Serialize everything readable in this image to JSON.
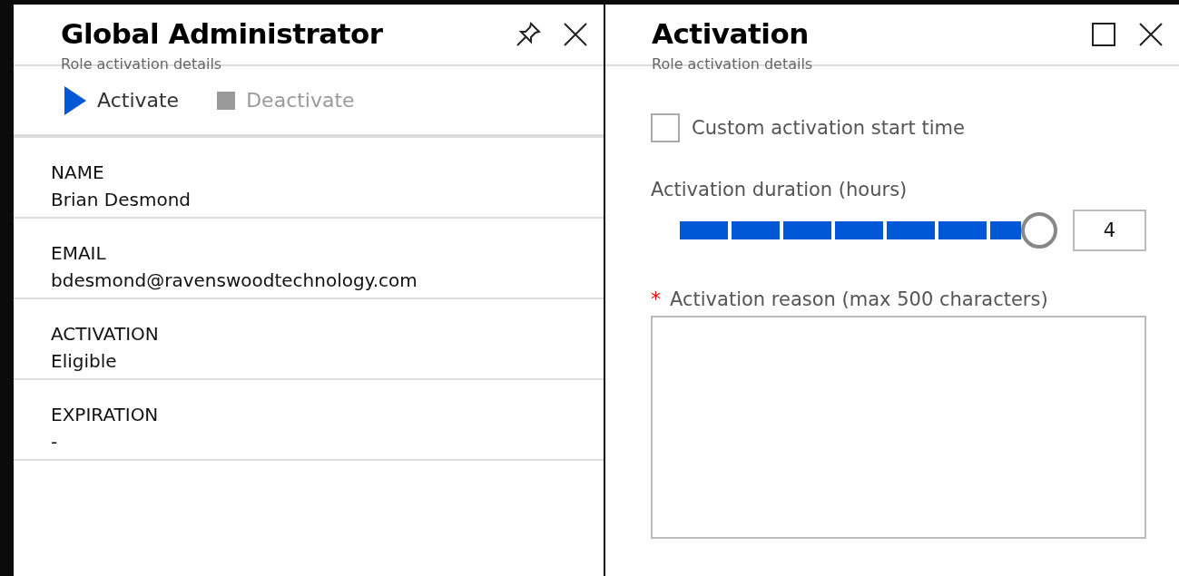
{
  "details_blade": {
    "title": "Global Administrator",
    "subtitle": "Role activation details",
    "toolbar": [
      {
        "kind": "play",
        "label": "Activate",
        "disabled": false
      },
      {
        "kind": "stop",
        "label": "Deactivate",
        "disabled": true
      }
    ],
    "fields": [
      {
        "label": "NAME",
        "value": "Brian Desmond"
      },
      {
        "label": "EMAIL",
        "value": "bdesmond@ravenswoodtechnology.com"
      },
      {
        "label": "ACTIVATION",
        "value": "Eligible"
      },
      {
        "label": "EXPIRATION",
        "value": "-"
      }
    ]
  },
  "activation_blade": {
    "title": "Activation",
    "subtitle": "Role activation details",
    "custom_start": {
      "label": "Custom activation start time",
      "checked": false
    },
    "duration": {
      "label": "Activation duration (hours)",
      "level": 1,
      "value": "4"
    },
    "reason": {
      "label": "Activation reason (max 500 characters)",
      "required": true,
      "required_mark": "*"
    }
  }
}
